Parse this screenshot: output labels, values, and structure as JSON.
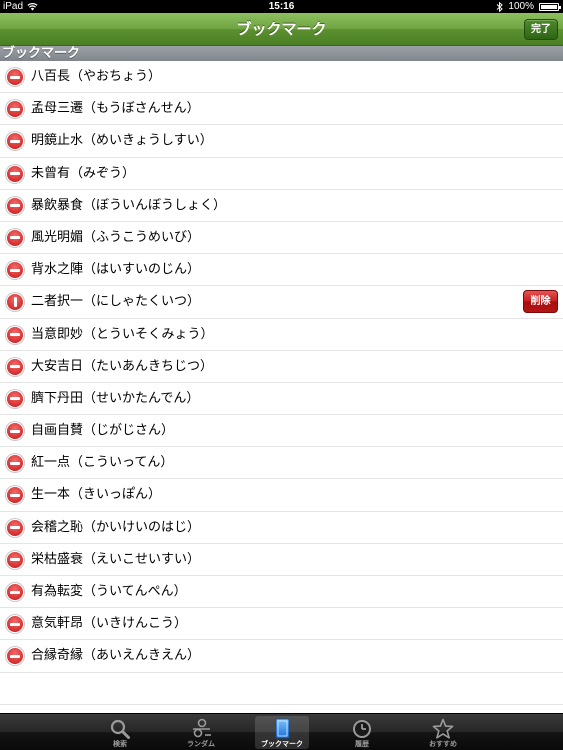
{
  "status_bar": {
    "device": "iPad",
    "time": "15:16",
    "battery": "100%"
  },
  "nav_bar": {
    "title": "ブックマーク",
    "done_label": "完了"
  },
  "section": {
    "header": "ブックマーク"
  },
  "bookmarks": [
    {
      "label": "八百長（やおちょう）"
    },
    {
      "label": "孟母三遷（もうぼさんせん）"
    },
    {
      "label": "明鏡止水（めいきょうしすい）"
    },
    {
      "label": "未曾有（みぞう）"
    },
    {
      "label": "暴飲暴食（ぼういんぼうしょく）"
    },
    {
      "label": "風光明媚（ふうこうめいび）"
    },
    {
      "label": "背水之陣（はいすいのじん）"
    },
    {
      "label": "二者択一（にしゃたくいつ）"
    },
    {
      "label": "当意即妙（とういそくみょう）"
    },
    {
      "label": "大安吉日（たいあんきちじつ）"
    },
    {
      "label": "臍下丹田（せいかたんでん）"
    },
    {
      "label": "自画自賛（じがじさん）"
    },
    {
      "label": "紅一点（こういってん）"
    },
    {
      "label": "生一本（きいっぽん）"
    },
    {
      "label": "会稽之恥（かいけいのはじ）"
    },
    {
      "label": "栄枯盛衰（えいこせいすい）"
    },
    {
      "label": "有為転変（ういてんぺん）"
    },
    {
      "label": "意気軒昂（いきけんこう）"
    },
    {
      "label": "合縁奇縁（あいえんきえん）"
    }
  ],
  "row_delete_label": "削除",
  "tabs": [
    {
      "label": "検索",
      "icon": "search-icon"
    },
    {
      "label": "ランダム",
      "icon": "random-icon"
    },
    {
      "label": "ブックマーク",
      "icon": "bookmark-icon"
    },
    {
      "label": "履歴",
      "icon": "history-icon"
    },
    {
      "label": "おすすめ",
      "icon": "star-icon"
    }
  ],
  "colors": {
    "nav_green": "#6fa341",
    "delete_red": "#c81414"
  }
}
